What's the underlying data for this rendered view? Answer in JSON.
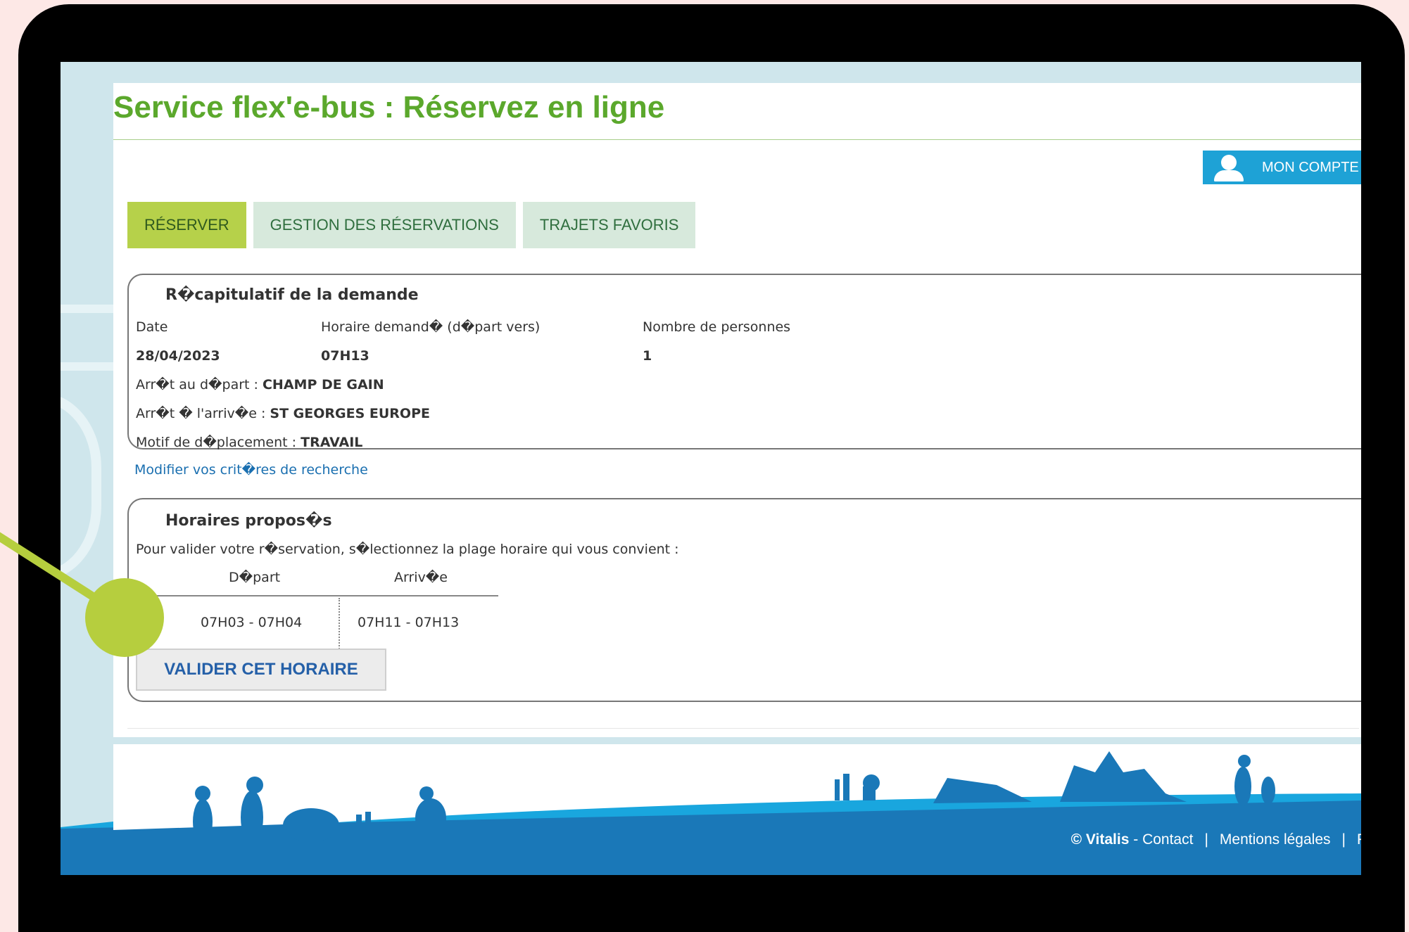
{
  "page": {
    "title": "Service flex'e-bus : Réservez en ligne",
    "account_label": "MON COMPTE"
  },
  "tabs": [
    {
      "label": "RÉSERVER",
      "active": true
    },
    {
      "label": "GESTION DES RÉSERVATIONS",
      "active": false
    },
    {
      "label": "TRAJETS FAVORIS",
      "active": false
    }
  ],
  "summary": {
    "heading": "R�capitulatif de la demande",
    "col_date": "Date",
    "col_time": "Horaire demand� (d�part vers)",
    "col_people": "Nombre de personnes",
    "date": "28/04/2023",
    "time": "07H13",
    "people": "1",
    "departure_label": "Arr�t au d�part : ",
    "departure_value": "CHAMP DE GAIN",
    "arrival_label": "Arr�t � l'arriv�e : ",
    "arrival_value": "ST GEORGES EUROPE",
    "motive_label": "Motif de d�placement : ",
    "motive_value": "TRAVAIL",
    "modify_link": "Modifier vos crit�res de recherche"
  },
  "schedules": {
    "heading": "Horaires propos�s",
    "instruction": "Pour valider votre r�servation, s�lectionnez la plage horaire qui vous convient :",
    "col_departure": "D�part",
    "col_arrival": "Arriv�e",
    "rows": [
      {
        "departure": "07H03 - 07H04",
        "arrival": "07H11 - 07H13",
        "selected": true
      }
    ],
    "validate_label": "VALIDER CET HORAIRE"
  },
  "footer": {
    "brand": "© Vitalis",
    "dash": " - ",
    "contact": "Contact",
    "separator": "|",
    "legal": "Mentions légales",
    "cut_link": "P"
  },
  "colors": {
    "title_green": "#5ba82c",
    "active_tab": "#b6d14a",
    "inactive_tab": "#d7e9dc",
    "account_blue": "#1ea2d6",
    "footer_blue": "#1a78b8",
    "pointer_green": "#b6ce3e"
  }
}
